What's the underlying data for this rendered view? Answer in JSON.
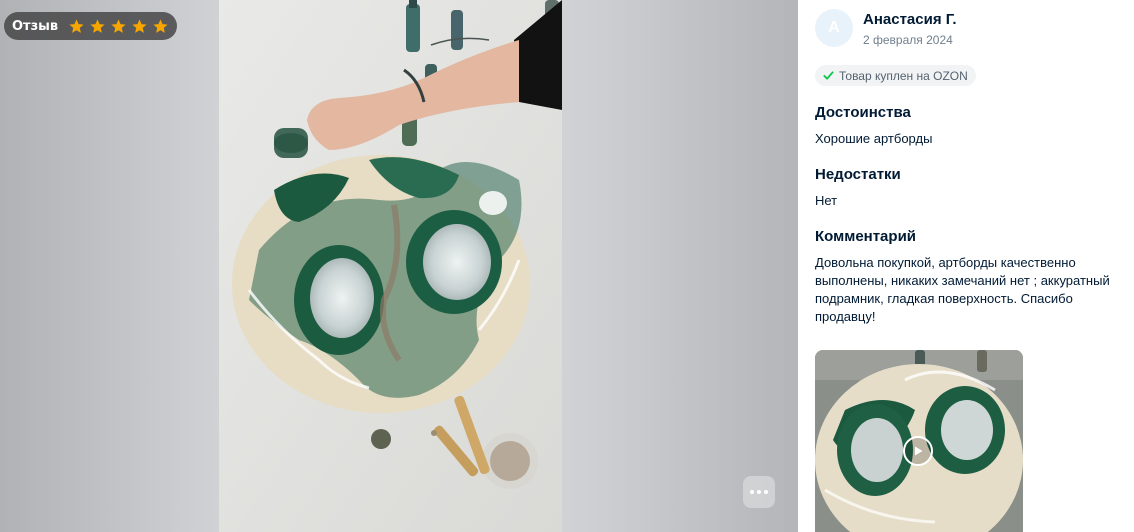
{
  "viewer": {
    "badge_label": "Отзыв",
    "rating": 5,
    "star_color": "#f7a600",
    "more_icon": "more-horizontal-icon"
  },
  "review": {
    "avatar_letter": "А",
    "author": "Анастасия Г.",
    "date": "2 февраля 2024",
    "verified_label": "Товар куплен на OZON",
    "verified_color": "#10c44c",
    "pros_title": "Достоинства",
    "pros_text": "Хорошие артборды",
    "cons_title": "Недостатки",
    "cons_text": "Нет",
    "comment_title": "Комментарий",
    "comment_text": "Довольна покупкой, артборды качественно выполнены, никаких замечаний нет ; аккуратный подрамник, гладкая поверхность. Спасибо продавцу!"
  },
  "media": {
    "thumbnail_icon": "play-icon"
  }
}
